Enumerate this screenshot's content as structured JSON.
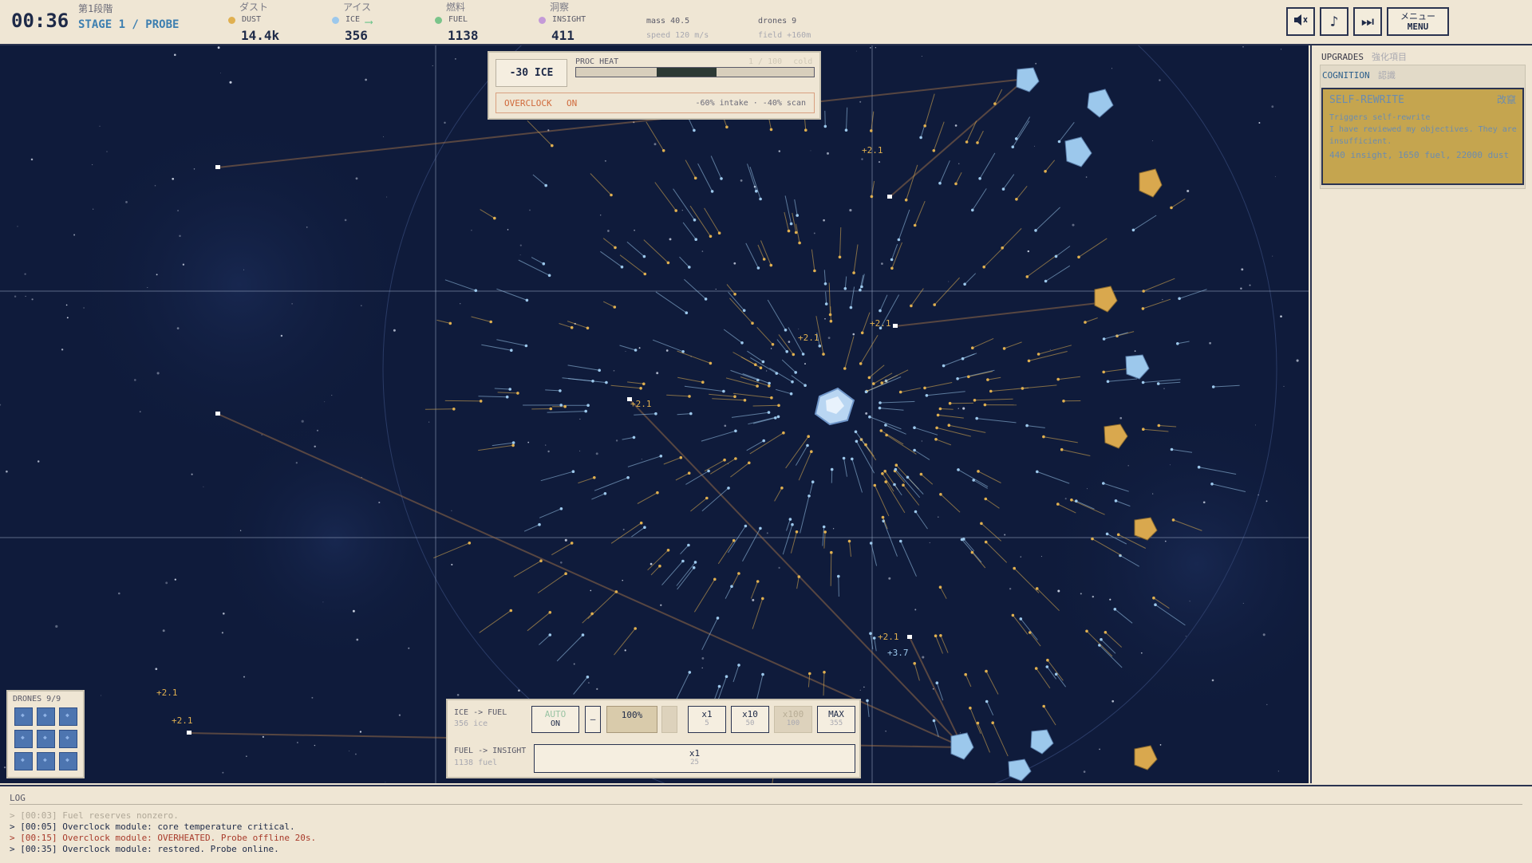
{
  "header": {
    "timer": "00:36",
    "stage_jp": "第1段階",
    "stage_en": "STAGE 1 / PROBE",
    "resources": [
      {
        "jp": "ダスト",
        "en": "DUST",
        "value": "14.4k",
        "color": "#e0b050"
      },
      {
        "jp": "アイス",
        "en": "ICE",
        "value": "356",
        "color": "#9cc8ec"
      },
      {
        "jp": "燃料",
        "en": "FUEL",
        "value": "1138",
        "color": "#7ac48a"
      },
      {
        "jp": "洞察",
        "en": "INSIGHT",
        "value": "411",
        "color": "#c49ad8"
      }
    ],
    "stats": {
      "mass": "mass 40.5",
      "speed": "speed 120 m/s",
      "drones": "drones 9",
      "field": "field +160m"
    },
    "buttons": {
      "mute_icon": "speaker-mute-icon",
      "music_icon": "music-note-icon",
      "skip_icon": "skip-forward-icon",
      "menu_jp": "メニュー",
      "menu_en": "MENU"
    }
  },
  "heat": {
    "ice_label": "-30 ICE",
    "label": "PROC HEAT",
    "scale": "1 / 100",
    "scale_unit": "cold",
    "level": 0.5,
    "overclock_label": "OVERCLOCK",
    "overclock_state": "ON",
    "overclock_effect": "-60% intake · -40% scan"
  },
  "converter": {
    "ice_to_fuel": {
      "label": "ICE -> FUEL",
      "sub": "356 ice",
      "auto": "AUTO",
      "auto_state": "ON",
      "minus": "–",
      "pct": "100%",
      "x1": "x1",
      "x1_sub": "5",
      "x10": "x10",
      "x10_sub": "50",
      "x100": "x100",
      "x100_sub": "100",
      "max": "MAX",
      "max_sub": "355"
    },
    "fuel_to_insight": {
      "label": "FUEL -> INSIGHT",
      "sub": "1138 fuel",
      "x1": "x1",
      "x1_sub": "25"
    }
  },
  "drones_panel": {
    "label": "DRONES 9/9",
    "count": 9
  },
  "floaters": [
    {
      "text": "+2.1"
    },
    {
      "text": "+2.1"
    },
    {
      "text": "+2.1"
    },
    {
      "text": "+2.1"
    },
    {
      "text": "+3.7"
    },
    {
      "text": "+2.1"
    },
    {
      "text": "+2.1"
    },
    {
      "text": "+2.1"
    }
  ],
  "sidebar": {
    "title": "UPGRADES",
    "title_jp": "強化項目",
    "section": "COGNITION",
    "section_jp": "認識",
    "card": {
      "title": "SELF-REWRITE",
      "title_jp": "改竄",
      "desc1": "Triggers self-rewrite",
      "desc2": "I have reviewed my objectives. They are insufficient.",
      "cost": "440 insight, 1650 fuel, 22000 dust"
    }
  },
  "log": {
    "title": "LOG",
    "lines": [
      "> [00:03] Fuel reserves nonzero.",
      "> [00:05] Overclock module: core temperature critical.",
      "> [00:15] Overclock module: OVERHEATED. Probe offline 20s.",
      "> [00:35] Overclock module: restored. Probe online."
    ]
  }
}
